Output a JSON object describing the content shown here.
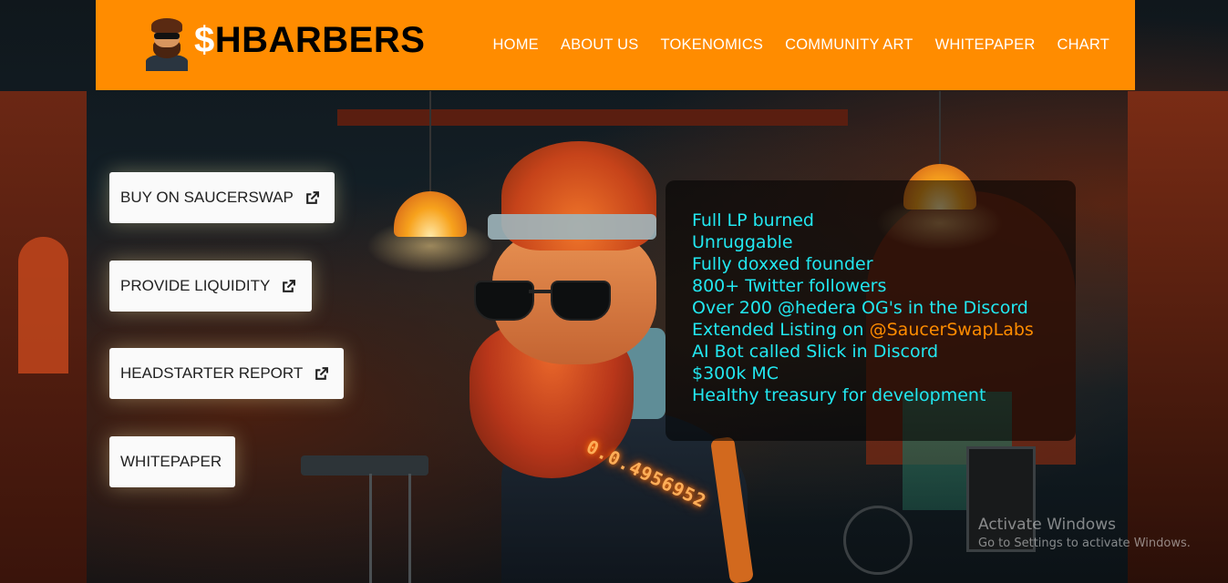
{
  "header": {
    "logo_dollar": "$",
    "logo_text": "HBARBERS",
    "nav": [
      {
        "label": "HOME"
      },
      {
        "label": "ABOUT US"
      },
      {
        "label": "TOKENOMICS"
      },
      {
        "label": "COMMUNITY ART"
      },
      {
        "label": "WHITEPAPER"
      },
      {
        "label": "CHART"
      }
    ]
  },
  "side_buttons": [
    {
      "label": "BUY ON SAUCERSWAP",
      "icon": "external-link-icon"
    },
    {
      "label": "PROVIDE LIQUIDITY",
      "icon": "external-link-icon"
    },
    {
      "label": "HEADSTARTER REPORT",
      "icon": "external-link-icon"
    },
    {
      "label": "WHITEPAPER"
    }
  ],
  "features": {
    "items": [
      "Full LP burned",
      "Unruggable",
      "Fully doxxed founder",
      "800+ Twitter followers",
      "Over 200 @hedera OG's in the Discord",
      "Extended Listing on ",
      "AI Bot called Slick in Discord",
      "$300k MC",
      "Healthy treasury for development"
    ],
    "extended_listing_handle": "@SaucerSwapLabs"
  },
  "hero": {
    "wallet_id": "0.0.4956952"
  },
  "watermark": {
    "title": "Activate Windows",
    "subtitle": "Go to Settings to activate Windows."
  },
  "colors": {
    "header_bg": "#ff8c00",
    "feature_text": "#22e7f0",
    "handle_accent": "#ff8c00"
  }
}
